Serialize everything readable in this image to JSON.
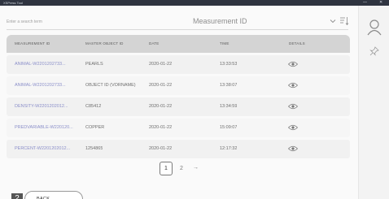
{
  "window": {
    "title": "XSPress Tool",
    "minimize_glyph": "—",
    "close_glyph": "✕"
  },
  "search": {
    "placeholder": "Enter a search term",
    "field_value": "Measurement ID",
    "chevron_icon": "chevron-down-icon",
    "sort_icon": "sort-icon"
  },
  "table": {
    "columns": [
      "MEASUREMENT ID",
      "MASTER OBJECT ID",
      "DATE",
      "TIME",
      "DETAILS"
    ],
    "rows": [
      {
        "measurement_id": "ANIMAL-W2201202733...",
        "object_id": "PEARLS",
        "date": "2020-01-22",
        "time": "13:33:53"
      },
      {
        "measurement_id": "ANIMAL-W2201202733...",
        "object_id": "OBJECT ID (VORNAME)",
        "date": "2020-01-22",
        "time": "13:38:07"
      },
      {
        "measurement_id": "DENSITY-W2201202012...",
        "object_id": "C85412",
        "date": "2020-01-22",
        "time": "13:34:59"
      },
      {
        "measurement_id": "PREDVARIABLE-W220120...",
        "object_id": "COPPER",
        "date": "2020-01-22",
        "time": "15:09:07"
      },
      {
        "measurement_id": "PERCENT-W2201202012...",
        "object_id": "1254865",
        "date": "2020-01-22",
        "time": "12:17:32"
      }
    ]
  },
  "pagination": {
    "current": "1",
    "next_page": "2",
    "next_arrow": "→"
  },
  "footer": {
    "step": "2",
    "back_label": "BACK"
  },
  "sidebar": {
    "user_icon": "user-icon",
    "pin_icon": "pin-icon"
  },
  "colors": {
    "link": "#8b8fc9",
    "header_bg": "#d4d4d4",
    "titlebar": "#2f3440"
  }
}
